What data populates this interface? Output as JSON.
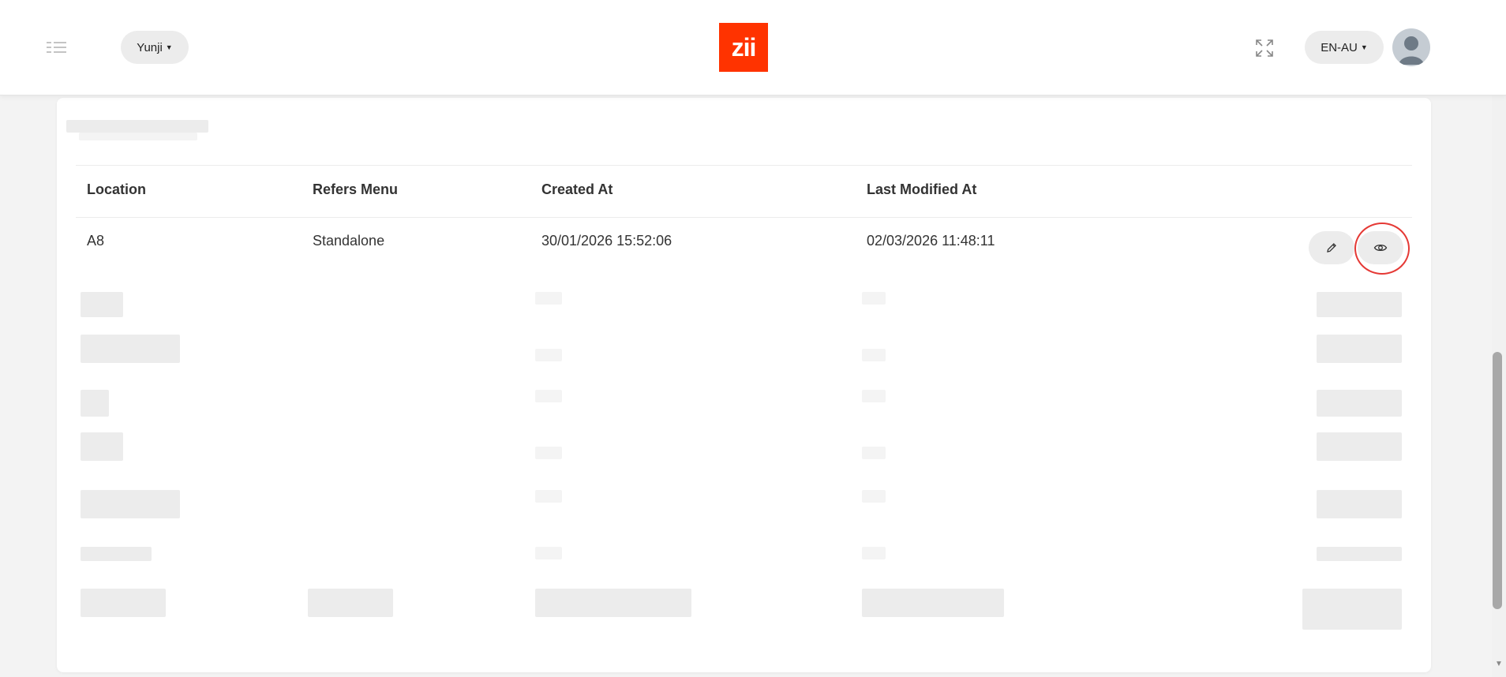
{
  "header": {
    "tenant_label": "Yunji",
    "logo_text": "zii",
    "language_label": "EN-AU",
    "icons": {
      "menu": "list-toggle-icon",
      "expand": "fullscreen-icon",
      "avatar": "user-avatar"
    },
    "colors": {
      "brand": "#ff3300",
      "highlight": "#e53935"
    }
  },
  "table": {
    "columns": [
      "Location",
      "Refers Menu",
      "Created At",
      "Last Modified At"
    ],
    "rows": [
      {
        "location": "A8",
        "refers_menu": "Standalone",
        "created_at": "30/01/2026 15:52:06",
        "last_modified_at": "02/03/2026 11:48:11",
        "actions": [
          "edit-icon",
          "view-icon"
        ]
      }
    ]
  }
}
